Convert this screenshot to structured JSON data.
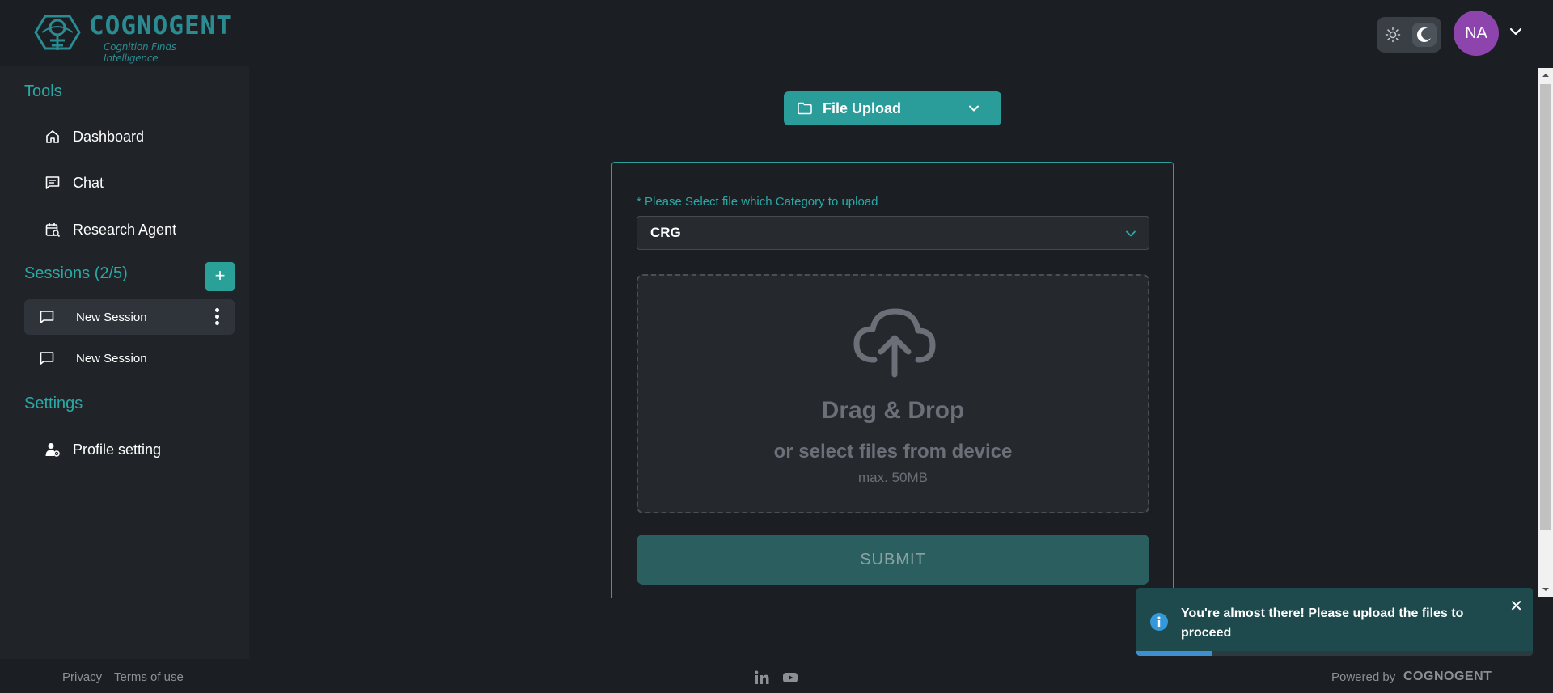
{
  "brand": {
    "name": "COGNOGENT",
    "tagline": "Cognition Finds Intelligence"
  },
  "header": {
    "theme_options": [
      "light",
      "dark"
    ],
    "theme_selected": "dark",
    "avatar_initials": "NA",
    "avatar_color": "#8e44ad"
  },
  "sidebar": {
    "tools_title": "Tools",
    "tools": [
      {
        "label": "Dashboard",
        "icon": "home-icon"
      },
      {
        "label": "Chat",
        "icon": "message-icon"
      },
      {
        "label": "Research Agent",
        "icon": "calendar-search-icon"
      }
    ],
    "sessions_title": "Sessions (2/5)",
    "sessions": [
      {
        "label": "New Session",
        "active": true
      },
      {
        "label": "New Session",
        "active": false
      }
    ],
    "settings_title": "Settings",
    "settings": [
      {
        "label": "Profile setting",
        "icon": "user-gear-icon"
      }
    ]
  },
  "main": {
    "mode_dropdown": {
      "label": "File Upload",
      "icon": "folder-icon"
    },
    "category_label": "* Please Select file which Category to upload",
    "category_value": "CRG",
    "dropzone": {
      "title": "Drag & Drop",
      "subtitle": "or select files from device",
      "max": "max. 50MB"
    },
    "submit_label": "SUBMIT"
  },
  "toast": {
    "message": "You're almost there! Please upload the files to proceed",
    "progress": 0.19
  },
  "footer": {
    "privacy": "Privacy",
    "terms": "Terms of use",
    "social": [
      "linkedin-icon",
      "youtube-icon"
    ],
    "powered_by": "Powered by",
    "powered_brand": "COGNOGENT"
  },
  "colors": {
    "accent": "#2aa198",
    "background": "#1b1f23",
    "sidebar": "#202428"
  }
}
